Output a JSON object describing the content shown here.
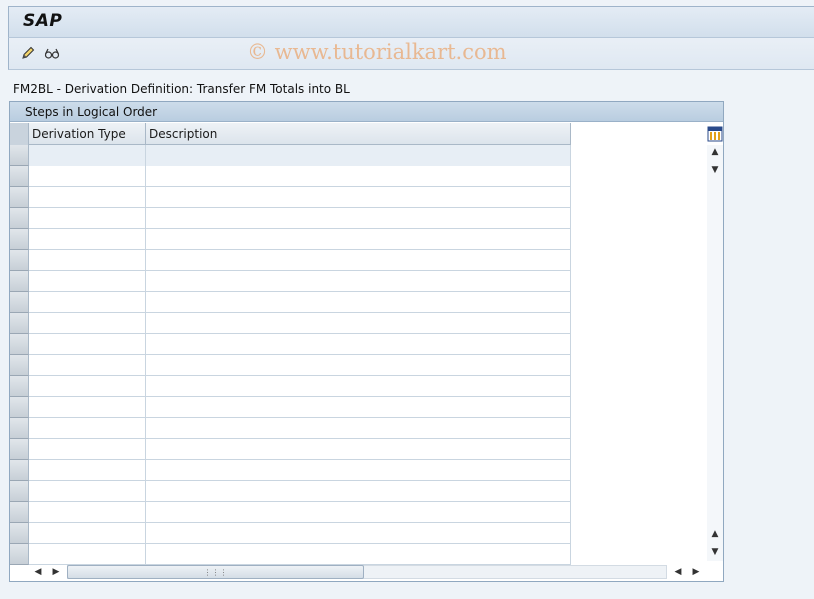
{
  "window": {
    "title": "SAP"
  },
  "toolbar": {
    "watermark": "© www.tutorialkart.com",
    "icons": [
      "edit-pencil-icon",
      "glasses-display-icon"
    ]
  },
  "page": {
    "title": "FM2BL - Derivation Definition: Transfer FM Totals into BL"
  },
  "panel": {
    "header": "Steps in Logical Order",
    "columns": [
      "Derivation Type",
      "Description"
    ],
    "row_count": 20,
    "settings_icon": "table-settings-icon"
  },
  "colors": {
    "background": "#eef3f8",
    "watermark": "#eb9650",
    "panel_header": "#c4d5e6"
  }
}
